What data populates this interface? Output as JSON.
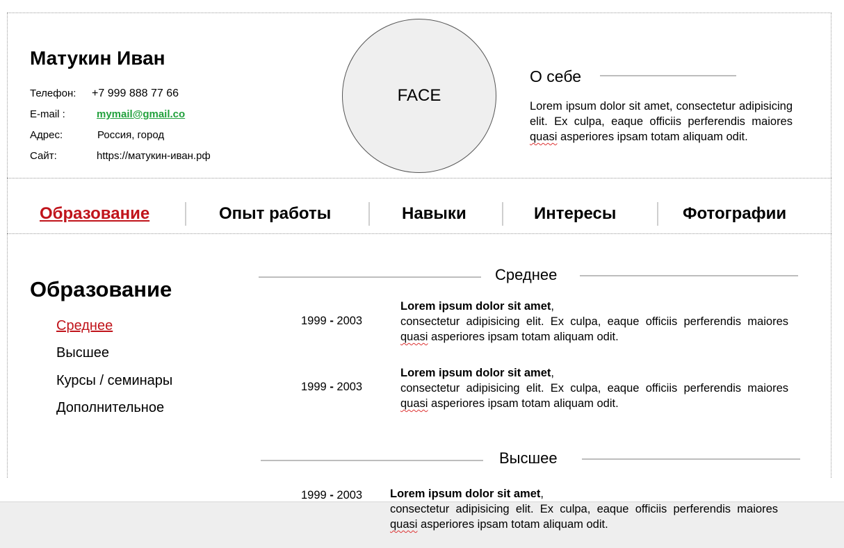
{
  "profile": {
    "name": "Матукин Иван",
    "photo_placeholder": "FACE",
    "contacts": [
      {
        "label": "Телефон:",
        "value": "+7  999 888 77 66"
      },
      {
        "label": "E-mail :",
        "value": "mymail@gmail.co"
      },
      {
        "label": "Адрес:",
        "value": "Россия, город"
      },
      {
        "label": "Сайт:",
        "value": "https://матукин-иван.рф"
      }
    ]
  },
  "about": {
    "title": "О себе",
    "text_before": "Lorem ipsum dolor sit amet, consectetur adipisicing elit. Ex culpa, eaque officiis perferendis maiores ",
    "text_flag": "quasi",
    "text_after": " asperiores ipsam totam aliquam odit."
  },
  "tabs": [
    {
      "label": "Образование",
      "active": true
    },
    {
      "label": "Опыт работы",
      "active": false
    },
    {
      "label": "Навыки",
      "active": false
    },
    {
      "label": "Интересы",
      "active": false
    },
    {
      "label": "Фотографии",
      "active": false
    }
  ],
  "education": {
    "title": "Образование",
    "nav": [
      {
        "label": "Среднее",
        "active": true
      },
      {
        "label": "Высшее",
        "active": false
      },
      {
        "label": "Курсы / семинары",
        "active": false
      },
      {
        "label": "Дополнительное",
        "active": false
      }
    ],
    "sections": [
      {
        "title": "Среднее",
        "entries": [
          {
            "date_start": "1999",
            "date_sep": "-",
            "date_end": "2003",
            "title": "Lorem ipsum dolor sit amet",
            "comma": ",",
            "text_before": "consectetur adipisicing elit. Ex culpa, eaque officiis perferendis maiores ",
            "text_flag": "quasi",
            "text_after": " asperiores ipsam totam aliquam odit."
          },
          {
            "date_start": "1999",
            "date_sep": "-",
            "date_end": "2003",
            "title": "Lorem ipsum dolor sit amet",
            "comma": ",",
            "text_before": "consectetur adipisicing elit. Ex culpa, eaque officiis perferendis maiores ",
            "text_flag": "quasi",
            "text_after": " asperiores ipsam totam aliquam odit."
          }
        ]
      },
      {
        "title": "Высшее",
        "entries": [
          {
            "date_start": "1999",
            "date_sep": "-",
            "date_end": "2003",
            "title": "Lorem ipsum dolor sit amet",
            "comma": ",",
            "text_before": "consectetur adipisicing elit. Ex culpa, eaque officiis perferendis maiores ",
            "text_flag": "quasi",
            "text_after": " asperiores ipsam totam aliquam odit."
          }
        ]
      }
    ]
  },
  "colors": {
    "accent_red": "#c0141b",
    "email_green": "#22a13d",
    "divider_gray": "#bdbdbd"
  }
}
